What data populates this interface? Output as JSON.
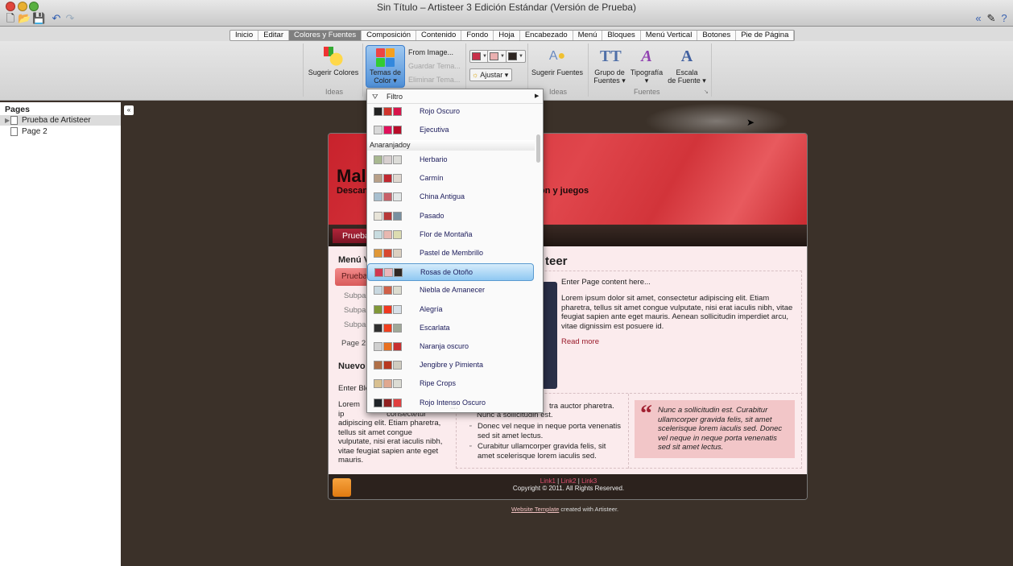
{
  "window": {
    "title": "Sin Título – Artisteer 3 Edición Estándar (Versión de Prueba)"
  },
  "toolbar": {
    "icons": [
      "new-file-icon",
      "open-folder-icon",
      "save-icon",
      "undo-icon",
      "redo-icon"
    ]
  },
  "tabs": [
    "Inicio",
    "Editar",
    "Colores y Fuentes",
    "Composición",
    "Contenido",
    "Fondo",
    "Hoja",
    "Encabezado",
    "Menú",
    "Bloques",
    "Menú Vertical",
    "Botones",
    "Pie de Página"
  ],
  "active_tab": "Colores y Fuentes",
  "ribbon": {
    "sugerir_colores": "Sugerir Colores",
    "temas_line1": "Temas de",
    "temas_line2": "Color ▾",
    "from_image": "From Image...",
    "guardar": "Guardar Tema...",
    "eliminar": "Eliminar Tema...",
    "ajustar": "Ajustar ▾",
    "swatches": [
      "#c8304a",
      "#eab0b0",
      "#2e2622"
    ],
    "sugerir_fuentes": "Sugerir Fuentes",
    "grupo1": "Grupo de",
    "grupo2": "Fuentes ▾",
    "tipo1": "Tipografía",
    "tipo2": "▾",
    "escala1": "Escala",
    "escala2": "de Fuente ▾",
    "group_ideas": "Ideas",
    "group_ideas2": "Ideas",
    "group_fuentes": "Fuentes"
  },
  "pages": {
    "header": "Pages",
    "items": [
      "Prueba de Artisteer",
      "Page 2"
    ],
    "selected": "Prueba de Artisteer"
  },
  "dropdown": {
    "filter": "Filtro",
    "items_before": [
      {
        "name": "Rojo Oscuro",
        "colors": [
          "#222222",
          "#d0342c",
          "#d8144a"
        ]
      },
      {
        "name": "Ejecutiva",
        "colors": [
          "#d8d8d8",
          "#e0105a",
          "#b80c2a"
        ]
      }
    ],
    "category": "Anaranjadoy",
    "items": [
      {
        "name": "Herbario",
        "colors": [
          "#a8b890",
          "#d8d0d0",
          "#dcdcd8"
        ]
      },
      {
        "name": "Carmín",
        "colors": [
          "#b8a088",
          "#c02830",
          "#e0d8d0"
        ]
      },
      {
        "name": "China Antigua",
        "colors": [
          "#a8c0d0",
          "#c86068",
          "#e4e8e8"
        ]
      },
      {
        "name": "Pasado",
        "colors": [
          "#e8e4d8",
          "#b83838",
          "#7890a0"
        ]
      },
      {
        "name": "Flor de Montaña",
        "colors": [
          "#c8dce0",
          "#e8b8b0",
          "#dcdcb0"
        ]
      },
      {
        "name": "Pastel de Membrillo",
        "colors": [
          "#e09838",
          "#d84830",
          "#dcd0c0"
        ]
      },
      {
        "name": "Rosas de Otoño",
        "colors": [
          "#d03850",
          "#eab8bc",
          "#2e2824"
        ],
        "selected": true
      },
      {
        "name": "Niebla de Amanecer",
        "colors": [
          "#c8d8e0",
          "#d06048",
          "#dcdcd0"
        ]
      },
      {
        "name": "Alegría",
        "colors": [
          "#809838",
          "#f03820",
          "#d8e0e8"
        ]
      },
      {
        "name": "Escarlata",
        "colors": [
          "#303030",
          "#f04020",
          "#a0a898"
        ]
      },
      {
        "name": "Naranja oscuro",
        "colors": [
          "#d0d0d0",
          "#e87020",
          "#c83030"
        ]
      },
      {
        "name": "Jengibre y Pimienta",
        "colors": [
          "#b07048",
          "#b83820",
          "#d0ccc0"
        ]
      },
      {
        "name": "Ripe Crops",
        "colors": [
          "#d8c090",
          "#e0a890",
          "#dcdcd4"
        ]
      },
      {
        "name": "Rojo Intenso Oscuro",
        "colors": [
          "#202428",
          "#902020",
          "#e04040"
        ]
      }
    ]
  },
  "preview": {
    "site_title": "Mala",
    "site_sub_left": "Descan",
    "site_sub_right": "on y juegos",
    "nav_item": "Prueba",
    "vmenu_title": "Menú V",
    "vmenu_active": "Prueba",
    "vmenu_subs": [
      "Subpa",
      "Subpa",
      "Subpa"
    ],
    "vmenu_page2": "Page 2",
    "block_title": "Nuevo",
    "block_enter": "Enter Blo",
    "block_text": "Lorem ip                    consectetur adipiscing elit. Etiam pharetra, tellus sit amet congue vulputate, nisi erat iaculis nibh, vitae feugiat sapien ante eget mauris.",
    "post_title": "teer",
    "post_enter": "Enter Page content here...",
    "post_text": "Lorem ipsum dolor sit amet, consectetur adipiscing elit. Etiam pharetra, tellus sit amet congue vulputate, nisi erat iaculis nibh, vitae feugiat sapien ante eget mauris. Aenean sollicitudin imperdiet arcu, vitae dignissim est posuere id.",
    "read_more": "Read more",
    "list_partial": "tra auctor pharetra.",
    "list_partial2": "Nunc a sollicitudin est.",
    "list": [
      "Donec vel neque in neque porta venenatis sed sit amet lectus.",
      "Curabitur ullamcorper gravida felis, sit amet scelerisque lorem iaculis sed."
    ],
    "quote": "Nunc a sollicitudin est. Curabitur ullamcorper gravida felis, sit amet scelerisque lorem iaculis sed. Donec vel neque in neque porta venenatis sed sit amet lectus.",
    "footer_links": [
      "Link1",
      "Link2",
      "Link3"
    ],
    "copyright": "Copyright © 2011. All Rights Reserved.",
    "credit_link": "Website Template",
    "credit_text": " created with Artisteer."
  }
}
